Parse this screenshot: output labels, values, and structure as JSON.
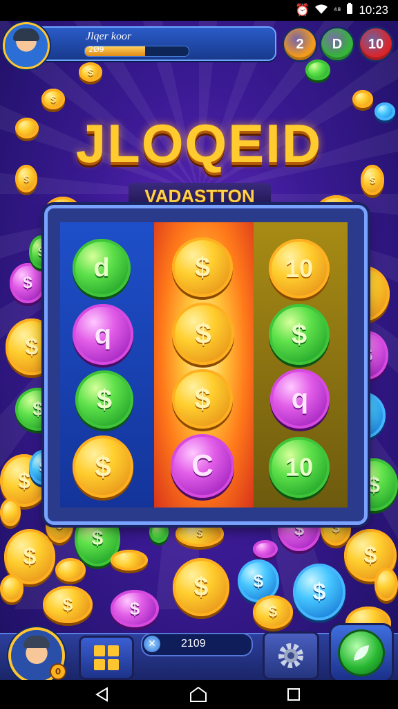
{
  "status_bar": {
    "time": "10:23",
    "icons": [
      "alarm-icon",
      "wifi-icon",
      "signal-icon"
    ],
    "signal_text": "⁴⁸"
  },
  "player": {
    "name": "Jlqer koor",
    "xp_text": "2Ø9",
    "xp_progress": 0.58
  },
  "top_buttons": [
    {
      "label": "2",
      "color": "#f39a1c"
    },
    {
      "label": "D",
      "color": "#36b53a"
    },
    {
      "label": "10",
      "color": "#d9262b"
    }
  ],
  "title": "JLOQEID",
  "subtitle": "VADASTTON",
  "reels": [
    [
      {
        "type": "green",
        "label": "d"
      },
      {
        "type": "purple",
        "label": "q"
      },
      {
        "type": "green",
        "label": "$"
      },
      {
        "type": "gold",
        "label": "$"
      }
    ],
    [
      {
        "type": "gold",
        "label": "$"
      },
      {
        "type": "gold",
        "label": "$"
      },
      {
        "type": "gold",
        "label": "$"
      },
      {
        "type": "purple",
        "label": "C"
      }
    ],
    [
      {
        "type": "gold",
        "label": "10"
      },
      {
        "type": "green",
        "label": "$"
      },
      {
        "type": "purple",
        "label": "q"
      },
      {
        "type": "green",
        "label": "10"
      }
    ]
  ],
  "bottom_hud": {
    "coin_text": "2109",
    "avatar_badge": "0"
  },
  "colors": {
    "gold": "#ffce2e",
    "green": "#5ee14a",
    "purple": "#e25ee8",
    "blue": "#46c6ff",
    "frame": "#7aa2ff"
  }
}
